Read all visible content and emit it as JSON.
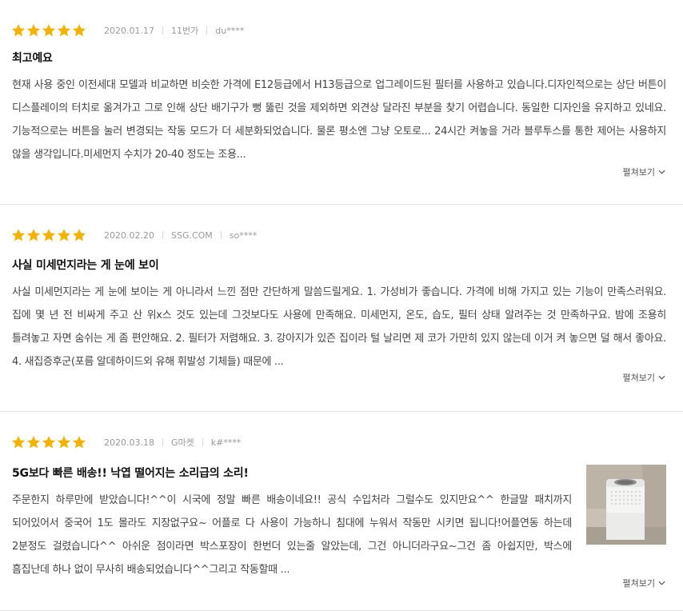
{
  "accent_star_color": "#f5b301",
  "more_label": "펼쳐보기",
  "reviews": [
    {
      "rating": 5,
      "date": "2020.01.17",
      "source": "11번가",
      "user": "du****",
      "title": "최고예요",
      "body": "현재 사용 중인 이전세대 모델과 비교하면 비슷한 가격에 E12등급에서 H13등급으로 업그레이드된 필터를 사용하고 있습니다.디자인적으로는 상단 버튼이 디스플레이의 터치로 옮겨가고 그로 인해 상단 배기구가 뻥 뚫린 것을 제외하면 외견상 달라진 부분을 찾기 어렵습니다. 동일한 디자인을 유지하고 있네요.기능적으로는 버튼을 눌러 변경되는 작동 모드가 더 세분화되었습니다. 물론 평소엔 그냥 오토로... 24시간 켜놓을 거라 블루투스를 통한 제어는 사용하지 않을 생각입니다.미세먼지 수치가 20-40 정도는 조용..."
    },
    {
      "rating": 5,
      "date": "2020.02.20",
      "source": "SSG.COM",
      "user": "so****",
      "title": "사실 미세먼지라는 게 눈에 보이",
      "body": "사실 미세먼지라는 게 눈에 보이는 게 아니라서 느낀 점만 간단하게 말씀드릴게요. 1. 가성비가 좋습니다. 가격에 비해 가지고 있는 기능이 만족스러워요. 집에 몇 년 전 비싸게 주고 산 위x스 것도 있는데 그것보다도 사용에 만족해요. 미세먼지, 온도, 습도, 필터 상태 알려주는 것 만족하구요. 밤에 조용히 틀려놓고 자면 숨쉬는 게 좀 편안해요. 2. 필터가 저렴해요. 3. 강아지가 있즌 집이라 털 날리면 제 코가 가만히 있지 않는데 이거 켜 놓으면 덜 해서 좋아요. 4. 새집증후군(포름 알데하이드외 유해 휘발성 기체들) 때문에 ..."
    },
    {
      "rating": 5,
      "date": "2020.03.18",
      "source": "G마켓",
      "user": "k#****",
      "title": "5G보다 빠른 배송!! 낙엽 떨어지는 소리급의 소리!",
      "body": "주문한지 하루만에 받았습니다!^^이 시국에 정말 빠른 배송이네요!! 공식 수입처라 그럴수도 있지만요^^ 한글말 패치까지 되어있어서 중국어 1도 몰라도 지장없구요~ 어플로 다 사용이 가능하니 침대에 누워서 작동만 시키면 됩니다!어플연동 하는데 2분정도 걸렸습니다^^ 아쉬운 점이라면 박스포장이 한번더 있는줄 알았는데, 그건 아니더라구요~그건 좀 아쉽지만, 박스에 흠집난데 하나 없이 무사히 배송되었습니다^^그리고 작동할때 ..."
    }
  ]
}
